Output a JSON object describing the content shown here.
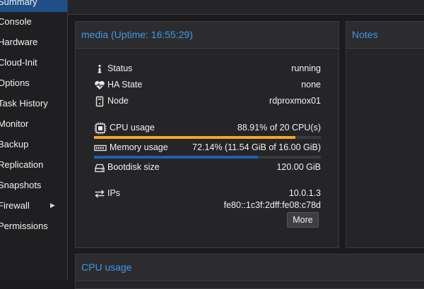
{
  "sidebar": {
    "items": [
      {
        "label": "Summary",
        "active": true
      },
      {
        "label": "Console"
      },
      {
        "label": "Hardware"
      },
      {
        "label": "Cloud-Init"
      },
      {
        "label": "Options"
      },
      {
        "label": "Task History"
      },
      {
        "label": "Monitor"
      },
      {
        "label": "Backup"
      },
      {
        "label": "Replication"
      },
      {
        "label": "Snapshots"
      },
      {
        "label": "Firewall",
        "has_submenu": true
      },
      {
        "label": "Permissions"
      }
    ]
  },
  "summary_panel": {
    "title": "media (Uptime: 16:55:29)",
    "status": {
      "label": "Status",
      "value": "running",
      "icon": "info-icon"
    },
    "ha_state": {
      "label": "HA State",
      "value": "none",
      "icon": "heartbeat-icon"
    },
    "node": {
      "label": "Node",
      "value": "rdproxmox01",
      "icon": "server-icon"
    },
    "cpu": {
      "label": "CPU usage",
      "value": "88.91% of 20 CPU(s)",
      "percent": 88.91,
      "color": "#f5a623",
      "icon": "cpu-icon"
    },
    "memory": {
      "label": "Memory usage",
      "value": "72.14% (11.54 GiB of 16.00 GiB)",
      "percent": 72.14,
      "color": "#1f5fb0",
      "icon": "memory-icon"
    },
    "bootdisk": {
      "label": "Bootdisk size",
      "value": "120.00 GiB",
      "icon": "hdd-icon"
    },
    "ips": {
      "label": "IPs",
      "icon": "exchange-icon",
      "values": [
        "10.0.1.3",
        "fe80::1c3f:2dff:fe08:c78d"
      ]
    },
    "more_label": "More"
  },
  "notes_panel": {
    "title": "Notes"
  },
  "cpu_panel": {
    "title": "CPU usage"
  },
  "colors": {
    "accent": "#3d9ae8",
    "active_nav": "#1f4f86",
    "background": "#1b1b1d"
  }
}
